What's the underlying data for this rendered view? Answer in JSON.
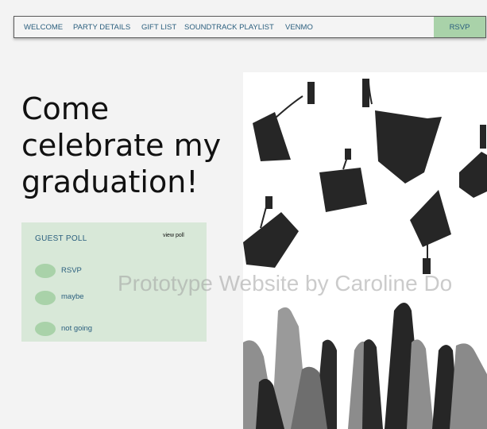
{
  "nav": {
    "items": [
      "WELCOME",
      "PARTY DETAILS",
      "GIFT LIST",
      "SOUNDTRACK PLAYLIST",
      "VENMO"
    ],
    "rsvp": "RSVP"
  },
  "hero": {
    "headline": "Come celebrate my graduation!"
  },
  "poll": {
    "title": "GUEST POLL",
    "view_link": "view poll",
    "options": [
      "RSVP",
      "maybe",
      "not going"
    ]
  },
  "watermark": "Prototype Website by Caroline Do",
  "colors": {
    "accent_green": "#a9d2a9",
    "poll_bg": "#d8e8d8",
    "link_blue": "#2b5f7e"
  }
}
